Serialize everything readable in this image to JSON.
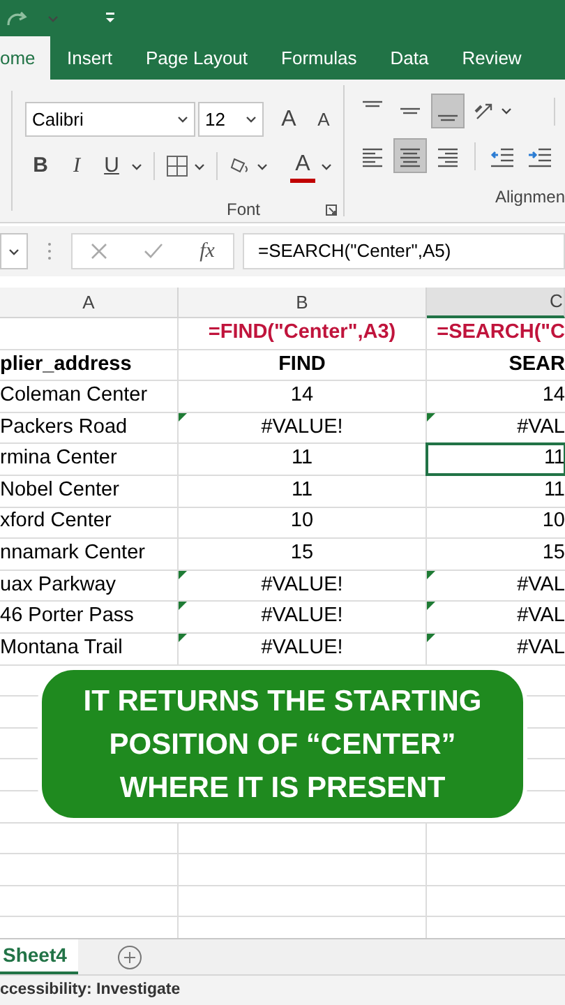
{
  "tabs": [
    {
      "label": "ome",
      "selected": true
    },
    {
      "label": "Insert",
      "selected": false
    },
    {
      "label": "Page Layout",
      "selected": false
    },
    {
      "label": "Formulas",
      "selected": false
    },
    {
      "label": "Data",
      "selected": false
    },
    {
      "label": "Review",
      "selected": false
    }
  ],
  "font_group": {
    "font_name": "Calibri",
    "font_size": "12",
    "grow": "A",
    "shrink": "A",
    "bold": "B",
    "italic": "I",
    "underline": "U",
    "font_color": "A",
    "label": "Font"
  },
  "alignment_group": {
    "label": "Alignmen",
    "buttons": [
      {
        "kind": "top",
        "selected": false
      },
      {
        "kind": "middle",
        "selected": false
      },
      {
        "kind": "bottom",
        "selected": true
      },
      {
        "kind": "orientation",
        "selected": false
      },
      {
        "kind": "left",
        "selected": false
      },
      {
        "kind": "center",
        "selected": true
      },
      {
        "kind": "right",
        "selected": false
      },
      {
        "kind": "outdent",
        "selected": false
      },
      {
        "kind": "indent",
        "selected": false
      }
    ]
  },
  "formula_bar": {
    "fx": "fx",
    "formula": "=SEARCH(\"Center\",A5)"
  },
  "columns": [
    {
      "label": "A",
      "selected": false
    },
    {
      "label": "B",
      "selected": false
    },
    {
      "label": "C",
      "selected": true
    }
  ],
  "rows": [
    {
      "kind": "formula",
      "b": "=FIND(\"Center\",A3)",
      "c": "=SEARCH(\"C",
      "error_flag": false,
      "active_cell": false
    },
    {
      "kind": "header",
      "a": "plier_address",
      "b": "FIND",
      "c": "SEAR",
      "error_flag": false,
      "active_cell": false
    },
    {
      "kind": "data",
      "a": "Coleman Center",
      "b": "14",
      "c": "14",
      "error_flag": false,
      "active_cell": false
    },
    {
      "kind": "data",
      "a": "Packers Road",
      "b": "#VALUE!",
      "c": "#VAL",
      "error_flag": true,
      "active_cell": false
    },
    {
      "kind": "data",
      "a": "rmina Center",
      "b": "11",
      "c": "11",
      "error_flag": false,
      "active_cell": true
    },
    {
      "kind": "data",
      "a": "Nobel Center",
      "b": "11",
      "c": "11",
      "error_flag": false,
      "active_cell": false
    },
    {
      "kind": "data",
      "a": "xford Center",
      "b": "10",
      "c": "10",
      "error_flag": false,
      "active_cell": false
    },
    {
      "kind": "data",
      "a": "nnamark Center",
      "b": "15",
      "c": "15",
      "error_flag": false,
      "active_cell": false
    },
    {
      "kind": "data",
      "a": "uax Parkway",
      "b": "#VALUE!",
      "c": "#VAL",
      "error_flag": true,
      "active_cell": false
    },
    {
      "kind": "data",
      "a": "46 Porter Pass",
      "b": "#VALUE!",
      "c": "#VAL",
      "error_flag": true,
      "active_cell": false
    },
    {
      "kind": "data",
      "a": "Montana Trail",
      "b": "#VALUE!",
      "c": "#VAL",
      "error_flag": true,
      "active_cell": false
    }
  ],
  "caption": {
    "text": "IT RETURNS THE STARTING POSITION OF “CENTER” WHERE IT IS PRESENT",
    "color": "#1f8a1f"
  },
  "sheet_tabs": [
    {
      "label": "Sheet4",
      "selected": true
    }
  ],
  "status_bar": {
    "text": "ccessibility: Investigate"
  }
}
